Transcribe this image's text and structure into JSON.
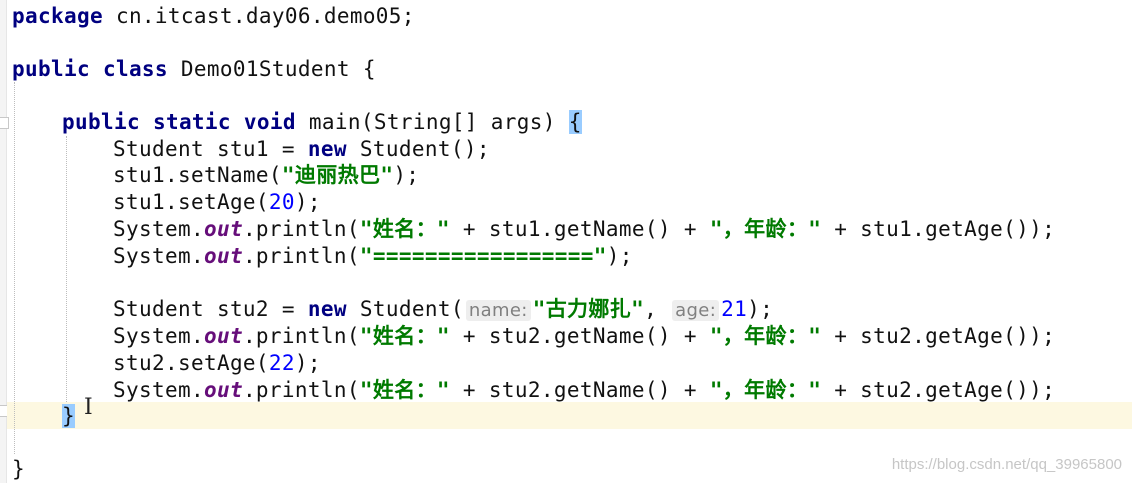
{
  "editor": {
    "package_kw": "package",
    "package_name": " cn.itcast.day06.demo05;",
    "class_kw": "public class",
    "class_name": " Demo01Student {",
    "main_kw": "public static void",
    "main_sig": " main(String[] args) ",
    "main_brace": "{",
    "lines": {
      "l4": {
        "a": "Student stu1 = ",
        "kw": "new",
        "b": " Student();"
      },
      "l5": {
        "a": "stu1.setName(",
        "str": "\"迪丽热巴\"",
        "b": ");"
      },
      "l6": {
        "a": "stu1.setAge(",
        "num": "20",
        "b": ");"
      },
      "l7": {
        "a": "System.",
        "fld": "out",
        "b": ".println(",
        "s1": "\"姓名：\"",
        "c": " + stu1.getName() + ",
        "s2": "\"，年龄：\"",
        "d": " + stu1.getAge());"
      },
      "l8": {
        "a": "System.",
        "fld": "out",
        "b": ".println(",
        "str": "\"=================\"",
        "c": ");"
      },
      "l9": {
        "a": "Student stu2 = ",
        "kw": "new",
        "b": " Student(",
        "hint1": "name:",
        "str": "\"古力娜扎\"",
        "c": ", ",
        "hint2": "age:",
        "num": "21",
        "d": ");"
      },
      "l10": {
        "a": "System.",
        "fld": "out",
        "b": ".println(",
        "s1": "\"姓名：\"",
        "c": " + stu2.getName() + ",
        "s2": "\"，年龄：\"",
        "d": " + stu2.getAge());"
      },
      "l11": {
        "a": "stu2.setAge(",
        "num": "22",
        "b": ");"
      },
      "l12": {
        "a": "System.",
        "fld": "out",
        "b": ".println(",
        "s1": "\"姓名：\"",
        "c": " + stu2.getName() + ",
        "s2": "\"，年龄：\"",
        "d": " + stu2.getAge());"
      }
    },
    "method_close": "}",
    "class_close": "}"
  },
  "watermark": "https://blog.csdn.net/qq_39965800"
}
